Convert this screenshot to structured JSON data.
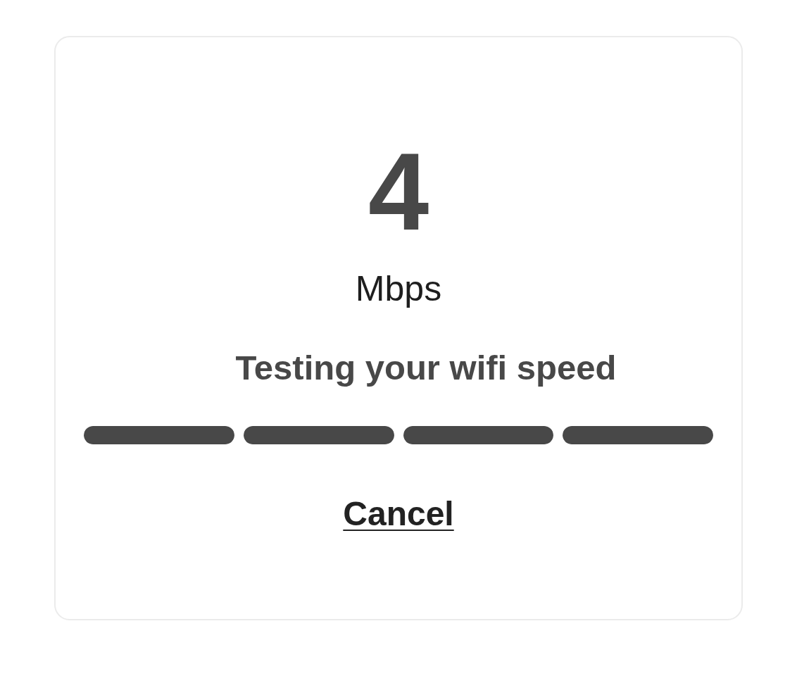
{
  "speed_test": {
    "value": "4",
    "unit": "Mbps",
    "status": "Testing your wifi speed",
    "progress_segments": [
      {
        "level": 1
      },
      {
        "level": 1
      },
      {
        "level": 1
      },
      {
        "level": 1
      }
    ],
    "cancel_link": "Cancel"
  }
}
